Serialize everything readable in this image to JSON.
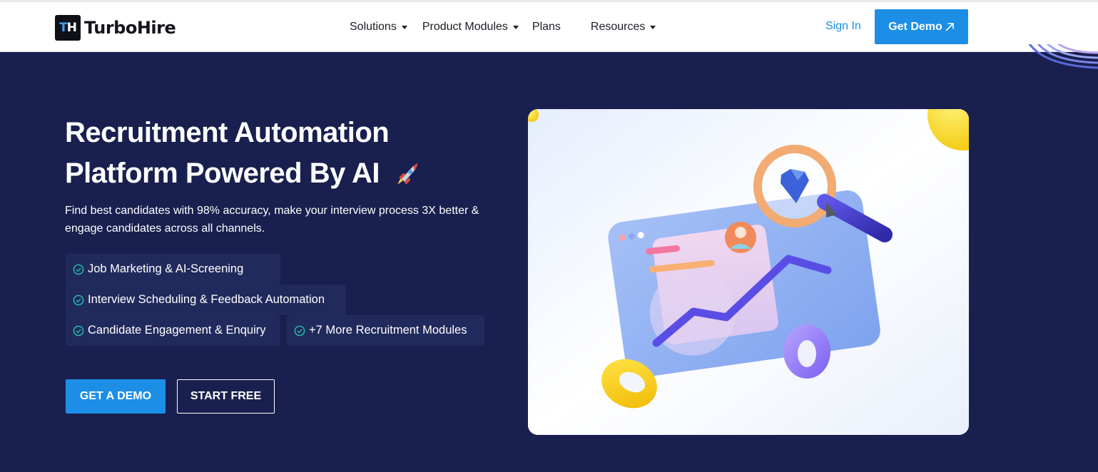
{
  "brand": {
    "mark_t": "T",
    "mark_h": "H",
    "name": "TurboHire"
  },
  "nav": {
    "items": [
      {
        "label": "Solutions",
        "has_caret": true
      },
      {
        "label": "Product Modules",
        "has_caret": true
      },
      {
        "label": "Plans",
        "has_caret": false
      },
      {
        "label": "Resources",
        "has_caret": true
      }
    ],
    "signin": "Sign In",
    "demo": "Get Demo"
  },
  "hero": {
    "title_line1": "Recruitment Automation",
    "title_line2": "Platform Powered By AI",
    "subtitle": "Find best candidates with 98% accuracy, make your interview process 3X better & engage candidates across all channels.",
    "features": [
      "Job Marketing & AI-Screening",
      "Interview Scheduling & Feedback Automation",
      "Candidate Engagement & Enquiry",
      "+7 More Recruitment Modules"
    ],
    "cta_primary": "GET A DEMO",
    "cta_secondary": "START FREE"
  },
  "colors": {
    "hero_bg": "#19204f",
    "accent": "#1d8ee6",
    "link": "#1a8fe3",
    "check": "#27c3b0"
  }
}
